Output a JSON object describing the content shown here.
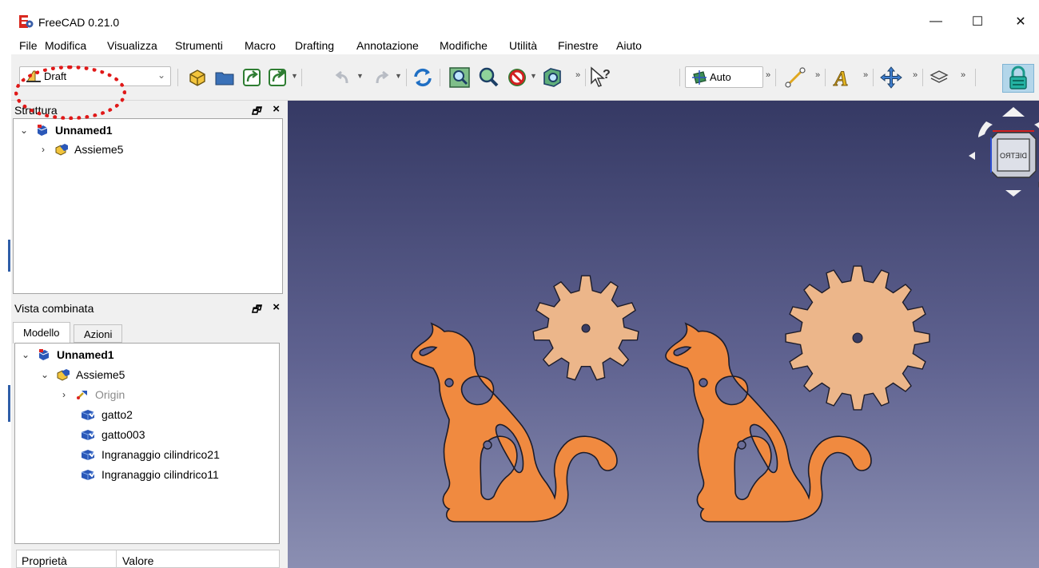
{
  "window": {
    "title": "FreeCAD 0.21.0",
    "controls": {
      "minimize": "—",
      "maximize": "☐",
      "close": "✕"
    }
  },
  "menu": [
    "File",
    "Modifica",
    "Visualizza",
    "Strumenti",
    "Macro",
    "Drafting",
    "Annotazione",
    "Modifiche",
    "Utilità",
    "Finestre",
    "Aiuto"
  ],
  "toolbar": {
    "workbench": "Draft",
    "snap_mode": "Auto",
    "overflow": "»",
    "icons": [
      "new-part-icon",
      "open-folder-icon",
      "export-icon",
      "export-as-icon",
      "undo-icon",
      "redo-icon",
      "refresh-icon",
      "fit-all-icon",
      "fit-selection-icon",
      "draw-style-icon",
      "bounding-box-icon",
      "whats-this-icon",
      "line-icon",
      "text-icon",
      "move-icon",
      "layer-icon",
      "lock-icon"
    ]
  },
  "structure_panel": {
    "title": "Struttura",
    "items": [
      {
        "label": "Unnamed1",
        "expanded": true,
        "bold": true
      },
      {
        "label": "Assieme5",
        "expanded": false
      }
    ]
  },
  "combo_panel": {
    "title": "Vista combinata",
    "tabs": [
      "Modello",
      "Azioni"
    ],
    "active_tab": "Modello",
    "tree": [
      {
        "label": "Unnamed1",
        "expanded": true,
        "bold": true
      },
      {
        "label": "Assieme5",
        "expanded": true
      },
      {
        "label": "Origin",
        "expanded": false,
        "dimmed": true
      },
      {
        "label": "gatto2"
      },
      {
        "label": "gatto003"
      },
      {
        "label": "Ingranaggio cilindrico21"
      },
      {
        "label": "Ingranaggio cilindrico11"
      }
    ],
    "property_columns": [
      "Proprietà",
      "Valore"
    ]
  },
  "navigation_cube": {
    "face": "DIETRO"
  },
  "colors": {
    "cat_fill": "#f08a40",
    "gear_fill": "#ecb68a",
    "highlight": "#e01818",
    "view_top": "#353964",
    "view_bottom": "#8b8fb2"
  }
}
